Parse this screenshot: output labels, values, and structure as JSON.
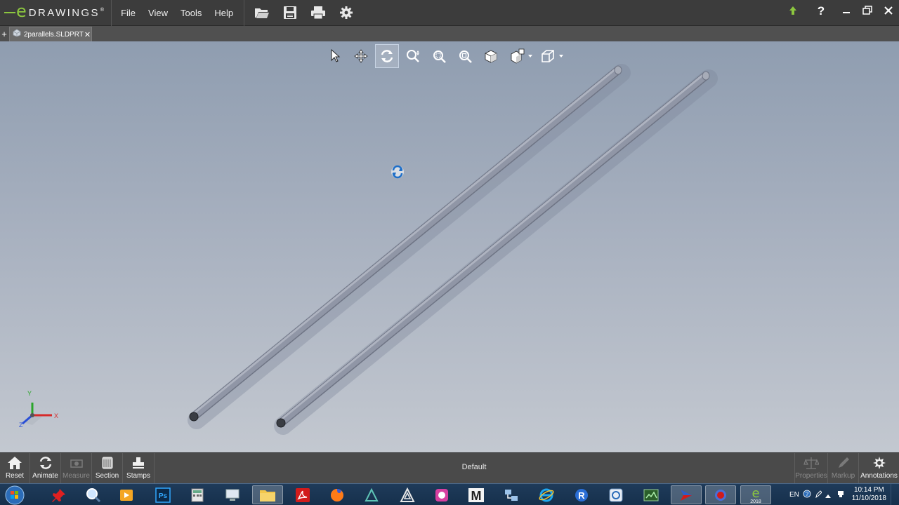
{
  "app": {
    "logo_letter": "e",
    "logo_text": "DRAWINGS",
    "logo_mark": "®",
    "menus": [
      "File",
      "View",
      "Tools",
      "Help"
    ],
    "file_buttons": [
      "open-folder-icon",
      "save-icon",
      "print-icon",
      "gear-icon"
    ],
    "window_buttons": [
      "upload-arrow-icon",
      "help-icon",
      "minimize-icon",
      "restore-icon",
      "close-icon"
    ]
  },
  "document": {
    "tab_plus": "+",
    "tab_name": "2parallels.SLDPRT",
    "tab_close": "✕"
  },
  "view_toolbar": {
    "tools": [
      "select-arrow-icon",
      "pan-icon",
      "rotate-icon",
      "zoom-icon",
      "zoom-to-area-icon",
      "zoom-to-fit-icon",
      "view-cube-icon",
      "standard-views-icon",
      "display-style-icon"
    ],
    "active_tool": "rotate-icon"
  },
  "triad": {
    "x_label": "X",
    "y_label": "Y",
    "z_label": "Z",
    "x_color": "#d62a2a",
    "y_color": "#2aa52a",
    "z_color": "#2a4fd6"
  },
  "bottom_left": [
    {
      "label": "Reset",
      "icon": "home-icon",
      "enabled": true
    },
    {
      "label": "Animate",
      "icon": "animate-icon",
      "enabled": true
    },
    {
      "label": "Measure",
      "icon": "measure-icon",
      "enabled": false
    },
    {
      "label": "Section",
      "icon": "section-icon",
      "enabled": true
    },
    {
      "label": "Stamps",
      "icon": "stamps-icon",
      "enabled": true
    }
  ],
  "configuration": "Default",
  "bottom_right": [
    {
      "label": "Properties",
      "icon": "properties-icon",
      "enabled": false
    },
    {
      "label": "Markup",
      "icon": "markup-pencil-icon",
      "enabled": false
    },
    {
      "label": "Annotations",
      "icon": "annotations-icon",
      "enabled": true
    }
  ],
  "taskbar": {
    "apps": [
      "start-orb-icon",
      "pin-app-icon",
      "search-app-icon",
      "media-player-icon",
      "photoshop-icon",
      "calculator-icon",
      "computer-icon",
      "file-explorer-icon",
      "acrobat-icon",
      "firefox-icon",
      "app-d-icon",
      "triangle-app-icon",
      "app-pink-icon",
      "app-m-icon",
      "network-app-icon",
      "internet-explorer-icon",
      "r-app-icon",
      "app-blue-icon",
      "app-green-icon",
      "app-red-arrow-icon",
      "record-app-icon",
      "edrawings-icon"
    ],
    "active_app_badge": "2018",
    "ps_label": "Ps",
    "m_label": "M",
    "r_label": "R",
    "lang": "EN",
    "time": "10:14 PM",
    "date": "11/10/2018"
  }
}
